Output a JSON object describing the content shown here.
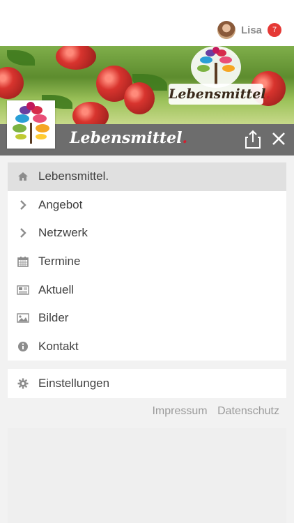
{
  "header": {
    "user_name": "Lisa",
    "notification_count": "7"
  },
  "banner": {
    "logo_text": "Lebensmittel"
  },
  "brand": {
    "title": "Lebensmittel",
    "dot": "."
  },
  "menu": {
    "items": [
      {
        "label": "Lebensmittel.",
        "icon": "home-icon"
      },
      {
        "label": "Angebot",
        "icon": "chevron-right-icon"
      },
      {
        "label": "Netzwerk",
        "icon": "chevron-right-icon"
      },
      {
        "label": "Termine",
        "icon": "calendar-icon"
      },
      {
        "label": "Aktuell",
        "icon": "newspaper-icon"
      },
      {
        "label": "Bilder",
        "icon": "image-icon"
      },
      {
        "label": "Kontakt",
        "icon": "info-icon"
      }
    ],
    "settings_label": "Einstellungen"
  },
  "footer": {
    "impressum": "Impressum",
    "datenschutz": "Datenschutz"
  },
  "colors": {
    "header_bar": "#6d6d6d",
    "badge": "#e53935",
    "brand_dot": "#d11f2f"
  }
}
